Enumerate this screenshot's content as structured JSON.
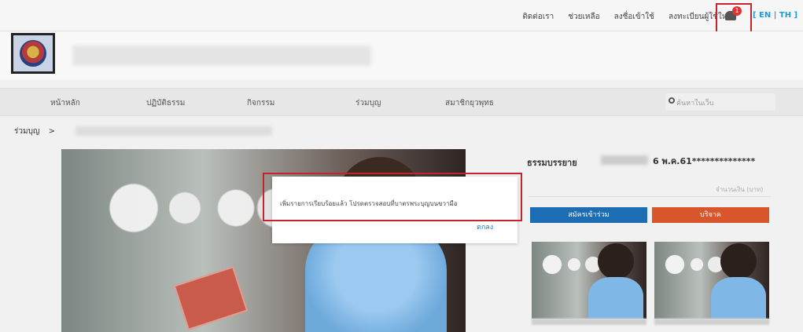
{
  "top_nav": {
    "links": [
      "ติดต่อเรา",
      "ช่วยเหลือ",
      "ลงชื่อเข้าใช้",
      "ลงทะเบียนผู้ใช้ใหม่"
    ],
    "notification_count": "1",
    "language": "[ EN | TH ]"
  },
  "main_nav": {
    "items": [
      "หน้าหลัก",
      "ปฏิบัติธรรม",
      "กิจกรรม",
      "ร่วมบุญ",
      "สมาชิกยุวพุทธ"
    ],
    "search_placeholder": "ค้นหาในเว็บ"
  },
  "breadcrumb": {
    "root": "ร่วมบุญ",
    "separator": ">"
  },
  "dialog": {
    "message": "เพิ่มรายการเรียบร้อยแล้ว โปรดตรวจสอบที่บาตรพระบุญบนขวามือ",
    "ok_label": "ตกลง"
  },
  "project": {
    "title": "ธรรมบรรยาย",
    "date_text": "6 พ.ค.61**************",
    "amount_label": "จำนวนเงิน (บาท)",
    "join_label": "สมัครเข้าร่วม",
    "donate_label": "บริจาค"
  },
  "colors": {
    "highlight": "#c4242b",
    "link": "#1b78b8",
    "join": "#1c6db4",
    "donate": "#d9552b"
  }
}
